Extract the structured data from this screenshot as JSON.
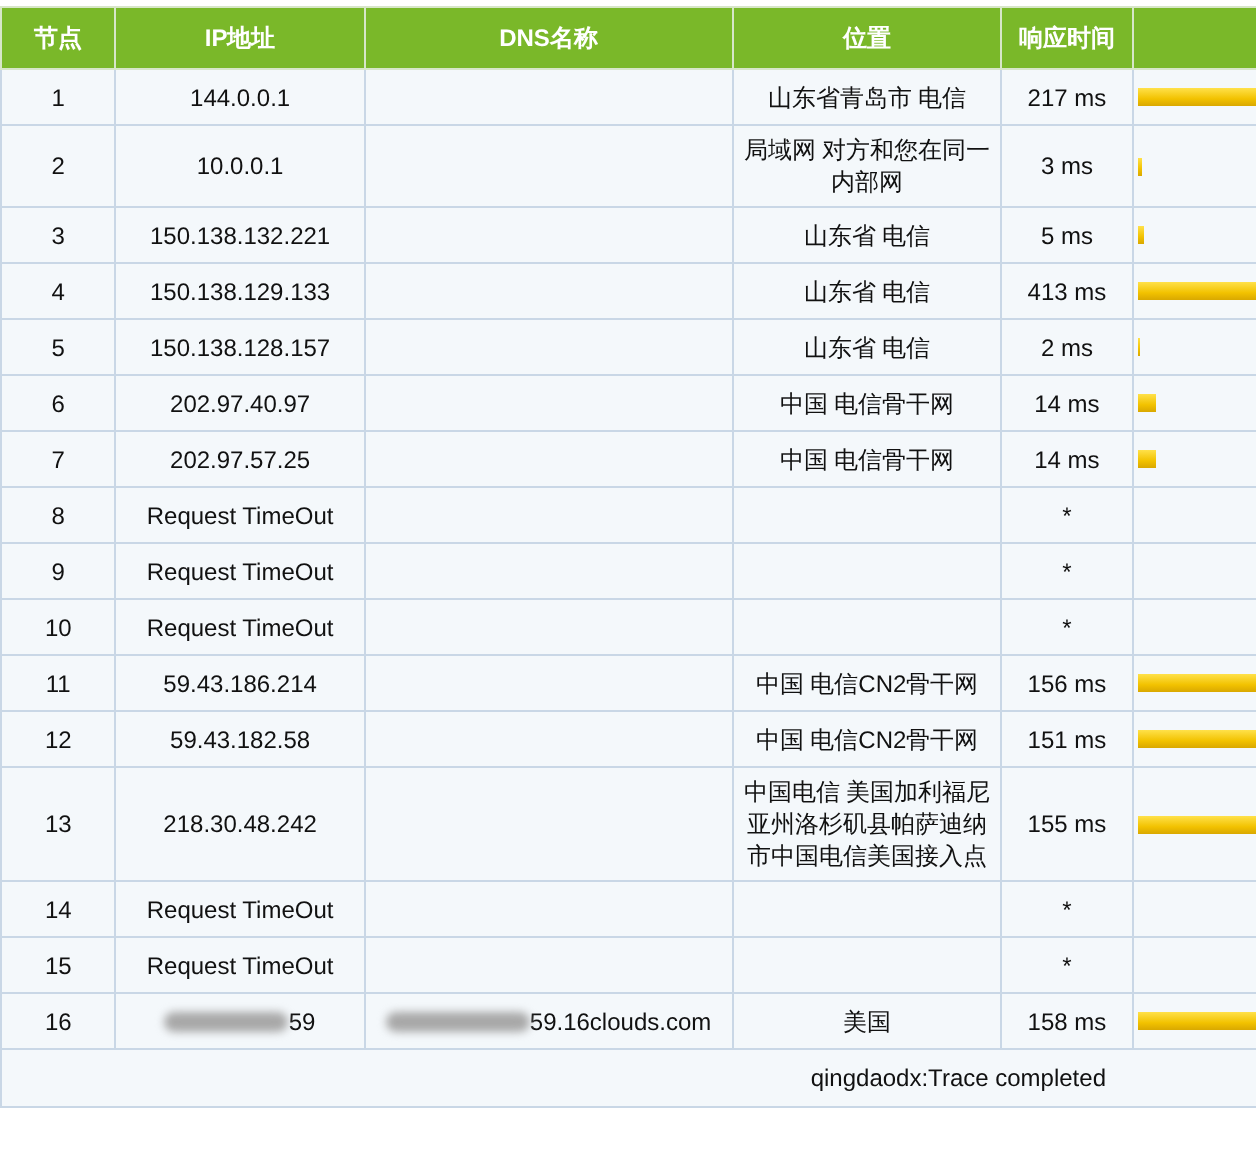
{
  "table": {
    "columns": [
      "节点",
      "IP地址",
      "DNS名称",
      "位置",
      "响应时间"
    ],
    "rows": [
      {
        "node": "1",
        "ip": "144.0.0.1",
        "dns": "",
        "location": "山东省青岛市 电信",
        "time": "217 ms",
        "level": 1,
        "redacted": false
      },
      {
        "node": "2",
        "ip": "10.0.0.1",
        "dns": "",
        "location": "局域网 对方和您在同一内部网",
        "time": "3 ms",
        "level": 0.04,
        "redacted": false
      },
      {
        "node": "3",
        "ip": "150.138.132.221",
        "dns": "",
        "location": "山东省 电信",
        "time": "5 ms",
        "level": 0.05,
        "redacted": false
      },
      {
        "node": "4",
        "ip": "150.138.129.133",
        "dns": "",
        "location": "山东省 电信",
        "time": "413 ms",
        "level": 1,
        "redacted": false
      },
      {
        "node": "5",
        "ip": "150.138.128.157",
        "dns": "",
        "location": "山东省 电信",
        "time": "2 ms",
        "level": 0.02,
        "redacted": false
      },
      {
        "node": "6",
        "ip": "202.97.40.97",
        "dns": "",
        "location": "中国 电信骨干网",
        "time": "14 ms",
        "level": 0.15,
        "redacted": false
      },
      {
        "node": "7",
        "ip": "202.97.57.25",
        "dns": "",
        "location": "中国 电信骨干网",
        "time": "14 ms",
        "level": 0.15,
        "redacted": false
      },
      {
        "node": "8",
        "ip": "Request TimeOut",
        "dns": "",
        "location": "",
        "time": "*",
        "redacted": false
      },
      {
        "node": "9",
        "ip": "Request TimeOut",
        "dns": "",
        "location": "",
        "time": "*",
        "redacted": false
      },
      {
        "node": "10",
        "ip": "Request TimeOut",
        "dns": "",
        "location": "",
        "time": "*",
        "redacted": false
      },
      {
        "node": "11",
        "ip": "59.43.186.214",
        "dns": "",
        "location": "中国 电信CN2骨干网",
        "time": "156 ms",
        "level": 1,
        "redacted": false
      },
      {
        "node": "12",
        "ip": "59.43.182.58",
        "dns": "",
        "location": "中国 电信CN2骨干网",
        "time": "151 ms",
        "level": 1,
        "redacted": false
      },
      {
        "node": "13",
        "ip": "218.30.48.242",
        "dns": "",
        "location": "中国电信 美国加利福尼亚州洛杉矶县帕萨迪纳市中国电信美国接入点",
        "time": "155 ms",
        "level": 1,
        "redacted": false
      },
      {
        "node": "14",
        "ip": "Request TimeOut",
        "dns": "",
        "location": "",
        "time": "*",
        "redacted": false
      },
      {
        "node": "15",
        "ip": "Request TimeOut",
        "dns": "",
        "location": "",
        "time": "*",
        "redacted": false
      },
      {
        "node": "16",
        "ip": "59",
        "dns": "59.16clouds.com",
        "location": "美国",
        "time": "158 ms",
        "level": 1,
        "redacted": true
      }
    ],
    "status": "qingdaodx:Trace completed"
  }
}
